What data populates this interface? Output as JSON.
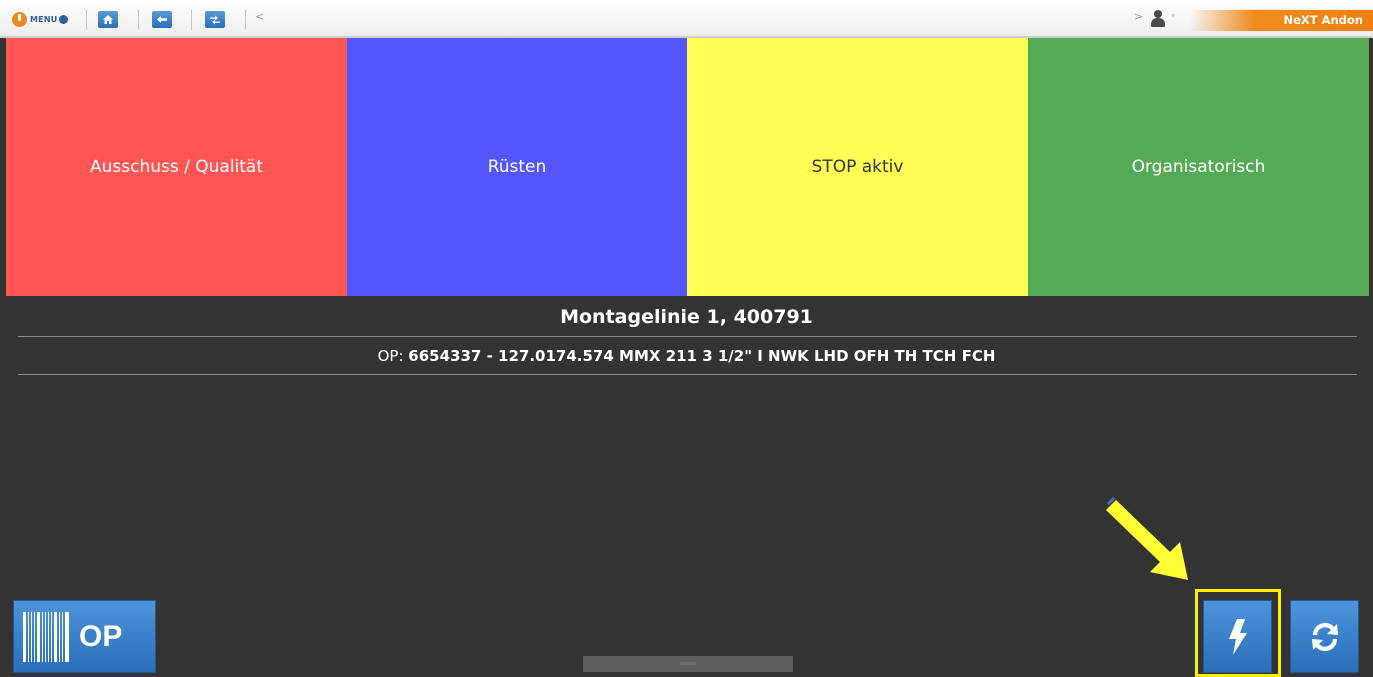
{
  "toolbar": {
    "menu_label": "MENU",
    "icons": [
      "power-icon",
      "home-icon",
      "back-arrow-icon",
      "swap-icon",
      "chevron-left-icon",
      "chevron-right-icon",
      "user-icon"
    ],
    "chevron_left": "<",
    "chevron_right": ">",
    "user_indicator": "°",
    "brand": "NeXT Andon"
  },
  "tiles": [
    {
      "label": "Ausschuss / Qualität",
      "color": "#ff5555"
    },
    {
      "label": "Rüsten",
      "color": "#5555ff"
    },
    {
      "label": "STOP aktiv",
      "color": "#ffff55"
    },
    {
      "label": "Organisatorisch",
      "color": "#55aa55"
    }
  ],
  "info": {
    "line_title": "Montagelinie 1, 400791",
    "op_label": "OP: ",
    "op_value": "6654337 - 127.0174.574 MMX 211 3 1/2\" I NWK LHD OFH TH TCH FCH"
  },
  "controls": {
    "op_button_label": "OP",
    "op_button_icon": "barcode-icon",
    "switch_button_icon": "lightning-icon",
    "refresh_button_icon": "refresh-icon",
    "highlight_color": "#ffee00"
  }
}
